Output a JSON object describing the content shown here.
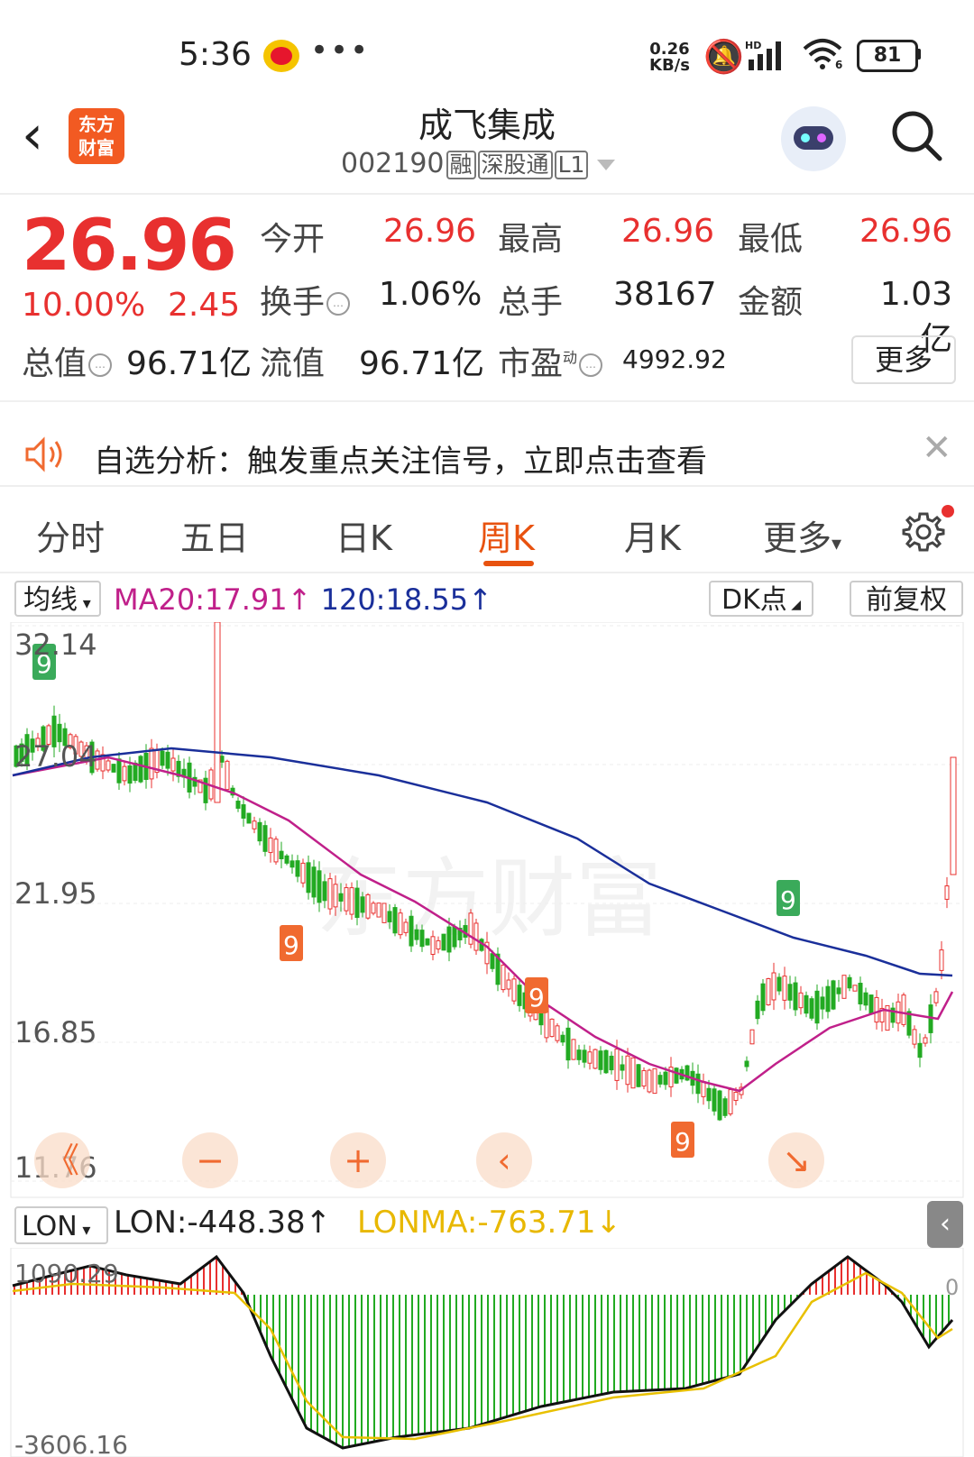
{
  "status": {
    "time": "5:36",
    "net_speed_top": "0.26",
    "net_speed_bottom": "KB/s",
    "signal": "HD",
    "wifi": "6",
    "battery": "81"
  },
  "header": {
    "title": "成飞集成",
    "code": "002190",
    "tags": [
      "融",
      "深股通",
      "L1"
    ],
    "logo_line1": "东方",
    "logo_line2": "财富"
  },
  "quote": {
    "price": "26.96",
    "pct": "10.00%",
    "change": "2.45",
    "rows": [
      [
        {
          "label": "今开",
          "value": "26.96",
          "red": true
        },
        {
          "label": "最高",
          "value": "26.96",
          "red": true
        },
        {
          "label": "最低",
          "value": "26.96",
          "red": true
        }
      ],
      [
        {
          "label": "换手",
          "value": "1.06%",
          "red": false
        },
        {
          "label": "总手",
          "value": "38167",
          "red": false
        },
        {
          "label": "金额",
          "value": "1.03亿",
          "red": false
        }
      ]
    ],
    "total_value_label": "总值",
    "total_value": "96.71亿",
    "float_label": "流值",
    "float_value": "96.71亿",
    "pe_label": "市盈",
    "pe_sup": "动",
    "pe_value": "4992.92",
    "more": "更多"
  },
  "alert": {
    "text": "自选分析：触发重点关注信号，立即点击查看"
  },
  "tabs": {
    "items": [
      "分时",
      "五日",
      "日K",
      "周K",
      "月K",
      "更多"
    ],
    "active": "周K"
  },
  "kline": {
    "ma_select": "均线",
    "ma20": "MA20:17.91",
    "ma120": "120:18.55",
    "dk": "DK点",
    "adjust": "前复权",
    "y_labels": [
      "32.14",
      "27.04",
      "21.95",
      "16.85",
      "11.76"
    ],
    "watermark": "东方财富",
    "colors": {
      "up": "#e8302f",
      "down": "#22aa22",
      "ma20": "#c0208a",
      "ma120": "#1a2f9a",
      "td": "#f06a30",
      "td_green": "#3aaa5a"
    }
  },
  "lon": {
    "select": "LON",
    "lon": "LON:-448.38",
    "lonma": "LONMA:-763.71",
    "y_top": "1090.29",
    "y_bottom": "-3606.16",
    "zero": "0"
  },
  "tools": {
    "rewind": "《",
    "minus": "−",
    "plus": "+",
    "prev": "‹",
    "expand": "↘"
  }
}
